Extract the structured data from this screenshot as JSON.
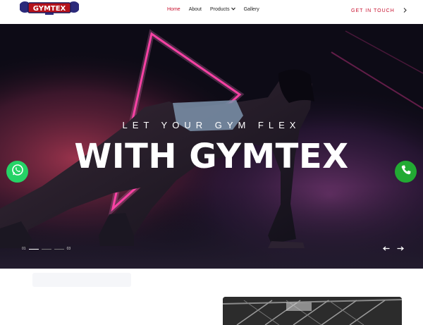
{
  "header": {
    "logo_text": "GYMTEX",
    "nav": [
      {
        "label": "Home",
        "active": true
      },
      {
        "label": "About",
        "active": false
      },
      {
        "label": "Products",
        "active": false,
        "has_dropdown": true
      },
      {
        "label": "Gallery",
        "active": false
      }
    ],
    "cta_label": "GET IN TOUCH",
    "cta_icon": "chevron-right-icon"
  },
  "hero": {
    "tagline": "LET YOUR GYM FLEX",
    "headline": "WITH GYMTEX",
    "pager": {
      "current": "01",
      "total": "03"
    },
    "prev_icon": "arrow-left-icon",
    "next_icon": "arrow-right-icon"
  },
  "floating": {
    "whatsapp_icon": "whatsapp-icon",
    "phone_icon": "phone-icon"
  },
  "colors": {
    "accent": "#c8102e",
    "whatsapp": "#25d366",
    "phone": "#22aa33",
    "neon": "#e0218a"
  }
}
